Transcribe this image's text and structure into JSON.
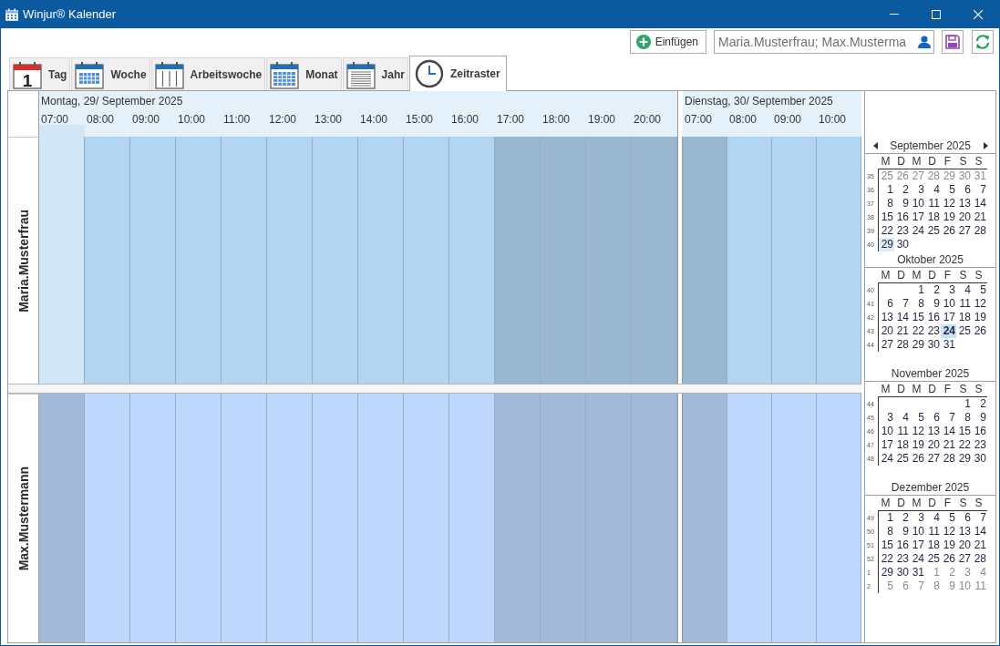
{
  "window": {
    "title": "Winjur® Kalender"
  },
  "toolbar": {
    "insert_button": "Einfügen",
    "participants_field": {
      "value": "Maria.Musterfrau; Max.Musterma"
    }
  },
  "tabs": [
    {
      "kind": "day",
      "label": "Tag",
      "icon_text": "1",
      "selected": false
    },
    {
      "kind": "week",
      "label": "Woche",
      "selected": false
    },
    {
      "kind": "workweek",
      "label": "Arbeitswoche",
      "selected": false
    },
    {
      "kind": "month",
      "label": "Monat",
      "selected": false
    },
    {
      "kind": "year",
      "label": "Jahr",
      "selected": false
    },
    {
      "kind": "timeline",
      "label": "Zeitraster",
      "selected": true
    }
  ],
  "schedule": {
    "days": [
      {
        "title": "Montag, 29/ September 2025",
        "hours": [
          {
            "label": "07:00",
            "working": false
          },
          {
            "label": "08:00",
            "working": true
          },
          {
            "label": "09:00",
            "working": true
          },
          {
            "label": "10:00",
            "working": true
          },
          {
            "label": "11:00",
            "working": true
          },
          {
            "label": "12:00",
            "working": true
          },
          {
            "label": "13:00",
            "working": true
          },
          {
            "label": "14:00",
            "working": true
          },
          {
            "label": "15:00",
            "working": true
          },
          {
            "label": "16:00",
            "working": true
          },
          {
            "label": "17:00",
            "working": false
          },
          {
            "label": "18:00",
            "working": false
          },
          {
            "label": "19:00",
            "working": false
          },
          {
            "label": "20:00",
            "working": false
          }
        ]
      },
      {
        "title": "Dienstag, 30/ September 2025",
        "hours": [
          {
            "label": "07:00",
            "working": false
          },
          {
            "label": "08:00",
            "working": true
          },
          {
            "label": "09:00",
            "working": true
          },
          {
            "label": "10:00",
            "working": true
          }
        ]
      }
    ],
    "resources": [
      {
        "name": "Maria.Musterfrau",
        "color": "#b2d5f1",
        "slots": [
          {
            "selected": true
          },
          {
            "selected": false
          },
          {
            "selected": false
          },
          {
            "selected": false
          },
          {
            "selected": false
          },
          {
            "selected": false
          },
          {
            "selected": false
          },
          {
            "selected": false
          },
          {
            "selected": false
          },
          {
            "selected": false
          },
          {
            "selected": false
          },
          {
            "selected": false
          },
          {
            "selected": false
          },
          {
            "selected": false
          },
          {
            "selected": false
          },
          {
            "selected": false
          },
          {
            "selected": false
          },
          {
            "selected": false
          }
        ]
      },
      {
        "name": "Max.Mustermann",
        "color": "#bfd7fc",
        "slots": [
          {
            "selected": false
          },
          {
            "selected": false
          },
          {
            "selected": false
          },
          {
            "selected": false
          },
          {
            "selected": false
          },
          {
            "selected": false
          },
          {
            "selected": false
          },
          {
            "selected": false
          },
          {
            "selected": false
          },
          {
            "selected": false
          },
          {
            "selected": false
          },
          {
            "selected": false
          },
          {
            "selected": false
          },
          {
            "selected": false
          },
          {
            "selected": false
          },
          {
            "selected": false
          },
          {
            "selected": false
          },
          {
            "selected": false
          }
        ]
      }
    ]
  },
  "mini_calendar": {
    "months": [
      {
        "title": "September 2025",
        "weekdays": [
          "M",
          "D",
          "M",
          "D",
          "F",
          "S",
          "S"
        ],
        "weeks": [
          {
            "number": "35",
            "days": [
              {
                "day": "25",
                "outside": true,
                "selected": false,
                "today": false
              },
              {
                "day": "26",
                "outside": true,
                "selected": false,
                "today": false
              },
              {
                "day": "27",
                "outside": true,
                "selected": false,
                "today": false
              },
              {
                "day": "28",
                "outside": true,
                "selected": false,
                "today": false
              },
              {
                "day": "29",
                "outside": true,
                "selected": false,
                "today": false
              },
              {
                "day": "30",
                "outside": true,
                "selected": false,
                "today": false
              },
              {
                "day": "31",
                "outside": true,
                "selected": false,
                "today": false
              }
            ]
          },
          {
            "number": "36",
            "days": [
              {
                "day": "1",
                "outside": false,
                "selected": false,
                "today": false
              },
              {
                "day": "2",
                "outside": false,
                "selected": false,
                "today": false
              },
              {
                "day": "3",
                "outside": false,
                "selected": false,
                "today": false
              },
              {
                "day": "4",
                "outside": false,
                "selected": false,
                "today": false
              },
              {
                "day": "5",
                "outside": false,
                "selected": false,
                "today": false
              },
              {
                "day": "6",
                "outside": false,
                "selected": false,
                "today": false
              },
              {
                "day": "7",
                "outside": false,
                "selected": false,
                "today": false
              }
            ]
          },
          {
            "number": "37",
            "days": [
              {
                "day": "8",
                "outside": false,
                "selected": false,
                "today": false
              },
              {
                "day": "9",
                "outside": false,
                "selected": false,
                "today": false
              },
              {
                "day": "10",
                "outside": false,
                "selected": false,
                "today": false
              },
              {
                "day": "11",
                "outside": false,
                "selected": false,
                "today": false
              },
              {
                "day": "12",
                "outside": false,
                "selected": false,
                "today": false
              },
              {
                "day": "13",
                "outside": false,
                "selected": false,
                "today": false
              },
              {
                "day": "14",
                "outside": false,
                "selected": false,
                "today": false
              }
            ]
          },
          {
            "number": "38",
            "days": [
              {
                "day": "15",
                "outside": false,
                "selected": false,
                "today": false
              },
              {
                "day": "16",
                "outside": false,
                "selected": false,
                "today": false
              },
              {
                "day": "17",
                "outside": false,
                "selected": false,
                "today": false
              },
              {
                "day": "18",
                "outside": false,
                "selected": false,
                "today": false
              },
              {
                "day": "19",
                "outside": false,
                "selected": false,
                "today": false
              },
              {
                "day": "20",
                "outside": false,
                "selected": false,
                "today": false
              },
              {
                "day": "21",
                "outside": false,
                "selected": false,
                "today": false
              }
            ]
          },
          {
            "number": "39",
            "days": [
              {
                "day": "22",
                "outside": false,
                "selected": false,
                "today": false
              },
              {
                "day": "23",
                "outside": false,
                "selected": false,
                "today": false
              },
              {
                "day": "24",
                "outside": false,
                "selected": false,
                "today": false
              },
              {
                "day": "25",
                "outside": false,
                "selected": false,
                "today": false
              },
              {
                "day": "26",
                "outside": false,
                "selected": false,
                "today": false
              },
              {
                "day": "27",
                "outside": false,
                "selected": false,
                "today": false
              },
              {
                "day": "28",
                "outside": false,
                "selected": false,
                "today": false
              }
            ]
          },
          {
            "number": "40",
            "days": [
              {
                "day": "29",
                "outside": false,
                "selected": true,
                "today": false
              },
              {
                "day": "30",
                "outside": false,
                "selected": false,
                "today": false
              }
            ]
          }
        ]
      },
      {
        "title": "Oktober 2025",
        "weekdays": [
          "M",
          "D",
          "M",
          "D",
          "F",
          "S",
          "S"
        ],
        "weeks": [
          {
            "number": "40",
            "days": [
              {
                "day": "1",
                "outside": false,
                "selected": false,
                "today": false
              },
              {
                "day": "2",
                "outside": false,
                "selected": false,
                "today": false
              },
              {
                "day": "3",
                "outside": false,
                "selected": false,
                "today": false
              },
              {
                "day": "4",
                "outside": false,
                "selected": false,
                "today": false
              },
              {
                "day": "5",
                "outside": false,
                "selected": false,
                "today": false
              }
            ]
          },
          {
            "number": "41",
            "days": [
              {
                "day": "6",
                "outside": false,
                "selected": false,
                "today": false
              },
              {
                "day": "7",
                "outside": false,
                "selected": false,
                "today": false
              },
              {
                "day": "8",
                "outside": false,
                "selected": false,
                "today": false
              },
              {
                "day": "9",
                "outside": false,
                "selected": false,
                "today": false
              },
              {
                "day": "10",
                "outside": false,
                "selected": false,
                "today": false
              },
              {
                "day": "11",
                "outside": false,
                "selected": false,
                "today": false
              },
              {
                "day": "12",
                "outside": false,
                "selected": false,
                "today": false
              }
            ]
          },
          {
            "number": "42",
            "days": [
              {
                "day": "13",
                "outside": false,
                "selected": false,
                "today": false
              },
              {
                "day": "14",
                "outside": false,
                "selected": false,
                "today": false
              },
              {
                "day": "15",
                "outside": false,
                "selected": false,
                "today": false
              },
              {
                "day": "16",
                "outside": false,
                "selected": false,
                "today": false
              },
              {
                "day": "17",
                "outside": false,
                "selected": false,
                "today": false
              },
              {
                "day": "18",
                "outside": false,
                "selected": false,
                "today": false
              },
              {
                "day": "19",
                "outside": false,
                "selected": false,
                "today": false
              }
            ]
          },
          {
            "number": "43",
            "days": [
              {
                "day": "20",
                "outside": false,
                "selected": false,
                "today": false
              },
              {
                "day": "21",
                "outside": false,
                "selected": false,
                "today": false
              },
              {
                "day": "22",
                "outside": false,
                "selected": false,
                "today": false
              },
              {
                "day": "23",
                "outside": false,
                "selected": false,
                "today": false
              },
              {
                "day": "24",
                "outside": false,
                "selected": false,
                "today": true
              },
              {
                "day": "25",
                "outside": false,
                "selected": false,
                "today": false
              },
              {
                "day": "26",
                "outside": false,
                "selected": false,
                "today": false
              }
            ]
          },
          {
            "number": "44",
            "days": [
              {
                "day": "27",
                "outside": false,
                "selected": false,
                "today": false
              },
              {
                "day": "28",
                "outside": false,
                "selected": false,
                "today": false
              },
              {
                "day": "29",
                "outside": false,
                "selected": false,
                "today": false
              },
              {
                "day": "30",
                "outside": false,
                "selected": false,
                "today": false
              },
              {
                "day": "31",
                "outside": false,
                "selected": false,
                "today": false
              }
            ]
          }
        ]
      },
      {
        "title": "November 2025",
        "weekdays": [
          "M",
          "D",
          "M",
          "D",
          "F",
          "S",
          "S"
        ],
        "weeks": [
          {
            "number": "44",
            "days": [
              {
                "day": "1",
                "outside": false,
                "selected": false,
                "today": false
              },
              {
                "day": "2",
                "outside": false,
                "selected": false,
                "today": false
              }
            ]
          },
          {
            "number": "45",
            "days": [
              {
                "day": "3",
                "outside": false,
                "selected": false,
                "today": false
              },
              {
                "day": "4",
                "outside": false,
                "selected": false,
                "today": false
              },
              {
                "day": "5",
                "outside": false,
                "selected": false,
                "today": false
              },
              {
                "day": "6",
                "outside": false,
                "selected": false,
                "today": false
              },
              {
                "day": "7",
                "outside": false,
                "selected": false,
                "today": false
              },
              {
                "day": "8",
                "outside": false,
                "selected": false,
                "today": false
              },
              {
                "day": "9",
                "outside": false,
                "selected": false,
                "today": false
              }
            ]
          },
          {
            "number": "46",
            "days": [
              {
                "day": "10",
                "outside": false,
                "selected": false,
                "today": false
              },
              {
                "day": "11",
                "outside": false,
                "selected": false,
                "today": false
              },
              {
                "day": "12",
                "outside": false,
                "selected": false,
                "today": false
              },
              {
                "day": "13",
                "outside": false,
                "selected": false,
                "today": false
              },
              {
                "day": "14",
                "outside": false,
                "selected": false,
                "today": false
              },
              {
                "day": "15",
                "outside": false,
                "selected": false,
                "today": false
              },
              {
                "day": "16",
                "outside": false,
                "selected": false,
                "today": false
              }
            ]
          },
          {
            "number": "47",
            "days": [
              {
                "day": "17",
                "outside": false,
                "selected": false,
                "today": false
              },
              {
                "day": "18",
                "outside": false,
                "selected": false,
                "today": false
              },
              {
                "day": "19",
                "outside": false,
                "selected": false,
                "today": false
              },
              {
                "day": "20",
                "outside": false,
                "selected": false,
                "today": false
              },
              {
                "day": "21",
                "outside": false,
                "selected": false,
                "today": false
              },
              {
                "day": "22",
                "outside": false,
                "selected": false,
                "today": false
              },
              {
                "day": "23",
                "outside": false,
                "selected": false,
                "today": false
              }
            ]
          },
          {
            "number": "48",
            "days": [
              {
                "day": "24",
                "outside": false,
                "selected": false,
                "today": false
              },
              {
                "day": "25",
                "outside": false,
                "selected": false,
                "today": false
              },
              {
                "day": "26",
                "outside": false,
                "selected": false,
                "today": false
              },
              {
                "day": "27",
                "outside": false,
                "selected": false,
                "today": false
              },
              {
                "day": "28",
                "outside": false,
                "selected": false,
                "today": false
              },
              {
                "day": "29",
                "outside": false,
                "selected": false,
                "today": false
              },
              {
                "day": "30",
                "outside": false,
                "selected": false,
                "today": false
              }
            ]
          }
        ]
      },
      {
        "title": "Dezember 2025",
        "weekdays": [
          "M",
          "D",
          "M",
          "D",
          "F",
          "S",
          "S"
        ],
        "weeks": [
          {
            "number": "49",
            "days": [
              {
                "day": "1",
                "outside": false,
                "selected": false,
                "today": false
              },
              {
                "day": "2",
                "outside": false,
                "selected": false,
                "today": false
              },
              {
                "day": "3",
                "outside": false,
                "selected": false,
                "today": false
              },
              {
                "day": "4",
                "outside": false,
                "selected": false,
                "today": false
              },
              {
                "day": "5",
                "outside": false,
                "selected": false,
                "today": false
              },
              {
                "day": "6",
                "outside": false,
                "selected": false,
                "today": false
              },
              {
                "day": "7",
                "outside": false,
                "selected": false,
                "today": false
              }
            ]
          },
          {
            "number": "50",
            "days": [
              {
                "day": "8",
                "outside": false,
                "selected": false,
                "today": false
              },
              {
                "day": "9",
                "outside": false,
                "selected": false,
                "today": false
              },
              {
                "day": "10",
                "outside": false,
                "selected": false,
                "today": false
              },
              {
                "day": "11",
                "outside": false,
                "selected": false,
                "today": false
              },
              {
                "day": "12",
                "outside": false,
                "selected": false,
                "today": false
              },
              {
                "day": "13",
                "outside": false,
                "selected": false,
                "today": false
              },
              {
                "day": "14",
                "outside": false,
                "selected": false,
                "today": false
              }
            ]
          },
          {
            "number": "51",
            "days": [
              {
                "day": "15",
                "outside": false,
                "selected": false,
                "today": false
              },
              {
                "day": "16",
                "outside": false,
                "selected": false,
                "today": false
              },
              {
                "day": "17",
                "outside": false,
                "selected": false,
                "today": false
              },
              {
                "day": "18",
                "outside": false,
                "selected": false,
                "today": false
              },
              {
                "day": "19",
                "outside": false,
                "selected": false,
                "today": false
              },
              {
                "day": "20",
                "outside": false,
                "selected": false,
                "today": false
              },
              {
                "day": "21",
                "outside": false,
                "selected": false,
                "today": false
              }
            ]
          },
          {
            "number": "52",
            "days": [
              {
                "day": "22",
                "outside": false,
                "selected": false,
                "today": false
              },
              {
                "day": "23",
                "outside": false,
                "selected": false,
                "today": false
              },
              {
                "day": "24",
                "outside": false,
                "selected": false,
                "today": false
              },
              {
                "day": "25",
                "outside": false,
                "selected": false,
                "today": false
              },
              {
                "day": "26",
                "outside": false,
                "selected": false,
                "today": false
              },
              {
                "day": "27",
                "outside": false,
                "selected": false,
                "today": false
              },
              {
                "day": "28",
                "outside": false,
                "selected": false,
                "today": false
              }
            ]
          },
          {
            "number": "1",
            "days": [
              {
                "day": "29",
                "outside": false,
                "selected": false,
                "today": false
              },
              {
                "day": "30",
                "outside": false,
                "selected": false,
                "today": false
              },
              {
                "day": "31",
                "outside": false,
                "selected": false,
                "today": false
              },
              {
                "day": "1",
                "outside": true,
                "selected": false,
                "today": false
              },
              {
                "day": "2",
                "outside": true,
                "selected": false,
                "today": false
              },
              {
                "day": "3",
                "outside": true,
                "selected": false,
                "today": false
              },
              {
                "day": "4",
                "outside": true,
                "selected": false,
                "today": false
              }
            ]
          },
          {
            "number": "2",
            "days": [
              {
                "day": "5",
                "outside": true,
                "selected": false,
                "today": false
              },
              {
                "day": "6",
                "outside": true,
                "selected": false,
                "today": false
              },
              {
                "day": "7",
                "outside": true,
                "selected": false,
                "today": false
              },
              {
                "day": "8",
                "outside": true,
                "selected": false,
                "today": false
              },
              {
                "day": "9",
                "outside": true,
                "selected": false,
                "today": false
              },
              {
                "day": "10",
                "outside": true,
                "selected": false,
                "today": false
              },
              {
                "day": "11",
                "outside": true,
                "selected": false,
                "today": false
              }
            ]
          }
        ]
      }
    ]
  }
}
